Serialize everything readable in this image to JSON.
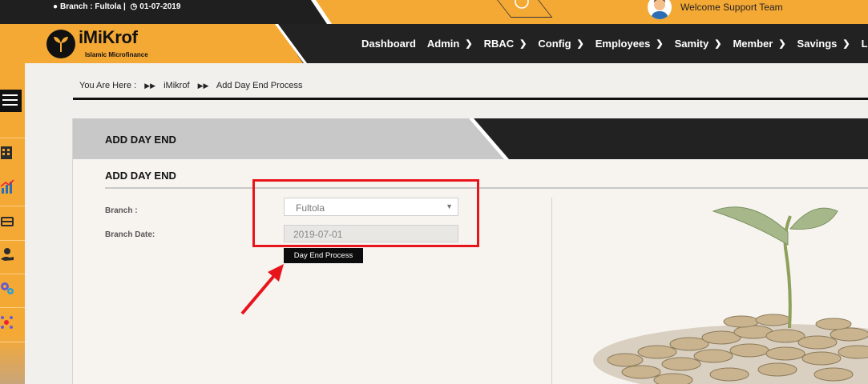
{
  "topbar": {
    "branch_info": "Branch : Fultola |",
    "date": "01-07-2019",
    "welcome": "Welcome Support Team"
  },
  "logo": {
    "name": "iMiKrof",
    "tagline": "Islamic Microfinance"
  },
  "nav": {
    "items": [
      {
        "label": "Dashboard",
        "has_menu": false
      },
      {
        "label": "Admin",
        "has_menu": true
      },
      {
        "label": "RBAC",
        "has_menu": true
      },
      {
        "label": "Config",
        "has_menu": true
      },
      {
        "label": "Employees",
        "has_menu": true
      },
      {
        "label": "Samity",
        "has_menu": true
      },
      {
        "label": "Member",
        "has_menu": true
      },
      {
        "label": "Savings",
        "has_menu": true
      },
      {
        "label": "Loans",
        "has_menu": false
      }
    ]
  },
  "breadcrumb": {
    "prefix": "You Are Here :",
    "items": [
      "iMikrof",
      "Add Day End Process"
    ]
  },
  "panel": {
    "title": "ADD DAY END",
    "section_title": "ADD DAY END"
  },
  "form": {
    "branch_label": "Branch :",
    "branch_value": "Fultola",
    "branch_date_label": "Branch Date:",
    "branch_date_value": "2019-07-01",
    "submit_label": "Day End Process"
  },
  "sidebar": {
    "icons": [
      "building-icon",
      "chart-icon",
      "cash-register-icon",
      "hand-money-icon",
      "gears-icon",
      "network-icon"
    ]
  },
  "colors": {
    "accent": "#f5a935",
    "dark": "#222222",
    "highlight": "#e8141b"
  }
}
